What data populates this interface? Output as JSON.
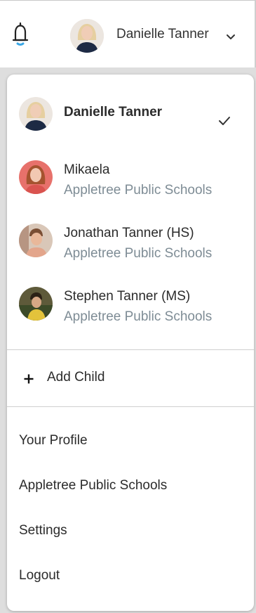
{
  "header": {
    "notification_icon": "bell-icon",
    "current_user": "Danielle Tanner",
    "chevron_icon": "chevron-down-icon"
  },
  "accounts": [
    {
      "name": "Danielle Tanner",
      "school": "",
      "selected": true,
      "avatar_color": "#d7c7b5"
    },
    {
      "name": "Mikaela",
      "school": "Appletree Public Schools",
      "selected": false,
      "avatar_color": "#d9534f"
    },
    {
      "name": "Jonathan Tanner (HS)",
      "school": "Appletree Public Schools",
      "selected": false,
      "avatar_color": "#c98a6b"
    },
    {
      "name": "Stephen Tanner (MS)",
      "school": "Appletree Public Schools",
      "selected": false,
      "avatar_color": "#6f6a3e"
    }
  ],
  "add_child": {
    "label": "Add Child",
    "icon": "plus-icon"
  },
  "links": {
    "profile": "Your Profile",
    "school": "Appletree Public Schools",
    "settings": "Settings",
    "logout": "Logout"
  },
  "colors": {
    "bell_indicator": "#3aa7e6",
    "secondary_text": "#7e8c95",
    "background": "#dedede"
  }
}
